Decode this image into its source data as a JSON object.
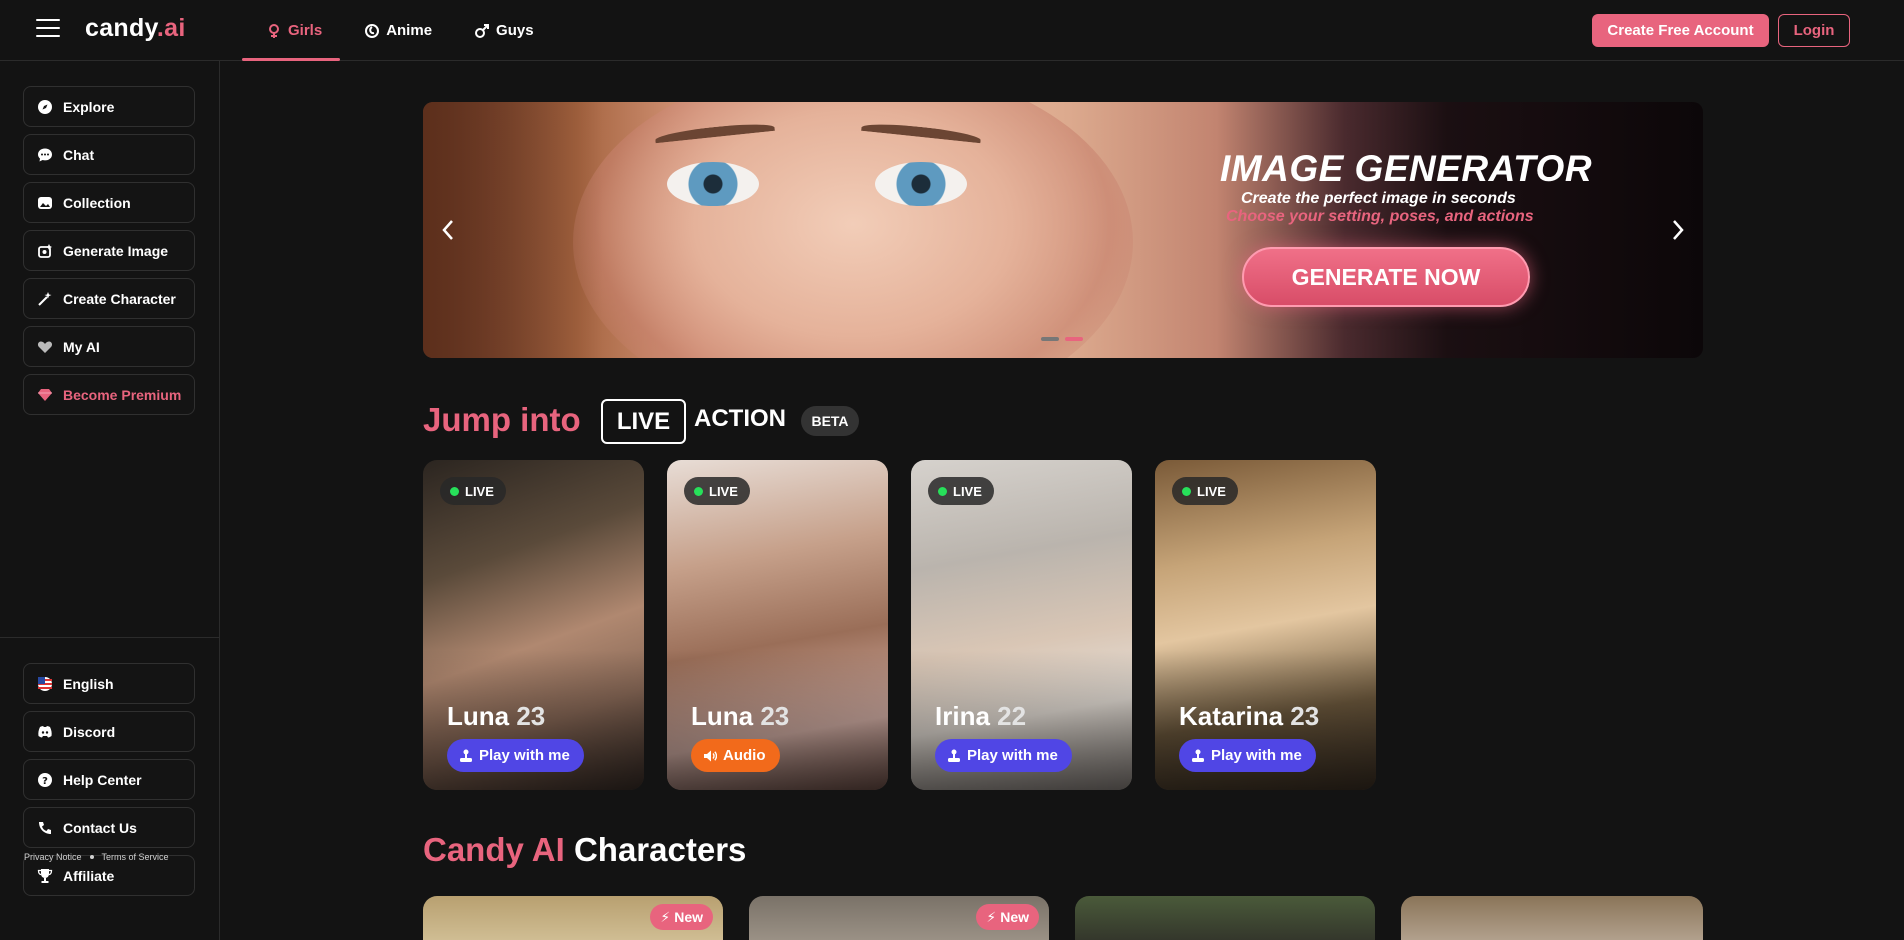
{
  "header": {
    "logo_main": "candy",
    "logo_accent": ".ai",
    "tabs": [
      {
        "label": "Girls",
        "icon": "female-icon",
        "active": true
      },
      {
        "label": "Anime",
        "icon": "anime-icon",
        "active": false
      },
      {
        "label": "Guys",
        "icon": "male-icon",
        "active": false
      }
    ],
    "create_account": "Create Free Account",
    "login": "Login"
  },
  "sidebar": {
    "items": [
      {
        "label": "Explore",
        "icon": "compass-icon"
      },
      {
        "label": "Chat",
        "icon": "chat-icon"
      },
      {
        "label": "Collection",
        "icon": "collection-icon"
      },
      {
        "label": "Generate Image",
        "icon": "generate-image-icon"
      },
      {
        "label": "Create Character",
        "icon": "magic-wand-icon"
      },
      {
        "label": "My AI",
        "icon": "heart-icon"
      },
      {
        "label": "Become Premium",
        "icon": "diamond-icon"
      }
    ],
    "bottom_items": [
      {
        "label": "English",
        "icon": "us-flag-icon"
      },
      {
        "label": "Discord",
        "icon": "discord-icon"
      },
      {
        "label": "Help Center",
        "icon": "help-icon"
      },
      {
        "label": "Contact Us",
        "icon": "contact-icon"
      },
      {
        "label": "Affiliate",
        "icon": "trophy-icon"
      }
    ],
    "privacy": "Privacy Notice",
    "terms": "Terms of Service"
  },
  "banner": {
    "title": "IMAGE GENERATOR",
    "subtitle": "Create the perfect image in seconds",
    "subtitle2": "Choose your setting, poses, and actions",
    "cta": "GENERATE NOW",
    "slide_count": 2,
    "active_slide": 2
  },
  "live_section": {
    "title_pink": "Jump into",
    "live": "LIVE",
    "action": "ACTION",
    "beta": "BETA",
    "cards": [
      {
        "badge": "LIVE",
        "name": "Luna",
        "age": "23",
        "button": "Play with me",
        "button_type": "play"
      },
      {
        "badge": "LIVE",
        "name": "Luna",
        "age": "23",
        "button": "Audio",
        "button_type": "audio"
      },
      {
        "badge": "LIVE",
        "name": "Irina",
        "age": "22",
        "button": "Play with me",
        "button_type": "play"
      },
      {
        "badge": "LIVE",
        "name": "Katarina",
        "age": "23",
        "button": "Play with me",
        "button_type": "play"
      }
    ]
  },
  "characters_section": {
    "title_pink": "Candy AI",
    "title_white": "Characters",
    "new_badge": "New"
  },
  "colors": {
    "accent": "#e8647e",
    "background": "#131313",
    "play_button": "#5046e5",
    "audio_button": "#f26a1b",
    "live_dot": "#27e05a"
  }
}
